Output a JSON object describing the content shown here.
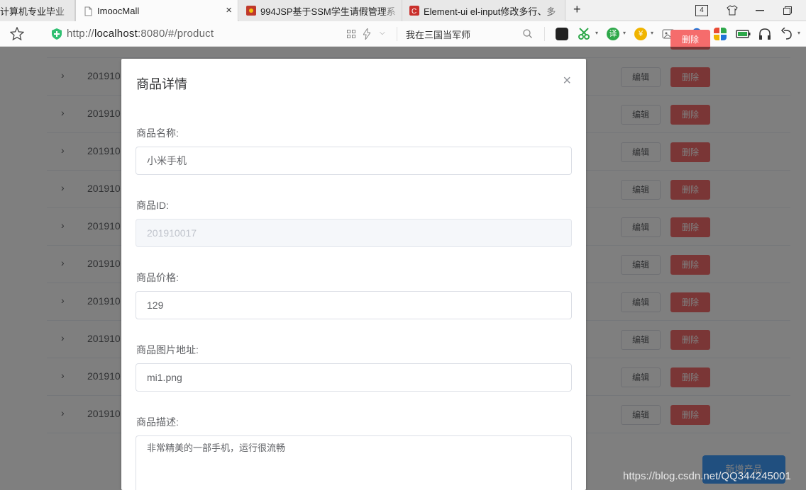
{
  "browser": {
    "tabs": [
      {
        "label": "计算机专业毕业",
        "active": false
      },
      {
        "label": "ImoocMall",
        "active": true
      },
      {
        "label": "994JSP基于SSM学生请假管理系",
        "active": false
      },
      {
        "label": "Element-ui el-input修改多行、多",
        "active": false
      }
    ],
    "tab_count": "4",
    "new_tab": "+",
    "close_tab": "×",
    "url_prefix": "http://",
    "url_host": "localhost",
    "url_rest": ":8080/#/product",
    "search_text": "我在三国当军师",
    "accent_green": "#2fbf71"
  },
  "table": {
    "row_id": "201910",
    "edit_label": "编辑",
    "delete_label": "删除",
    "row_count": 10
  },
  "add_button": "新增产品",
  "dialog": {
    "title": "商品详情",
    "close": "×",
    "fields": {
      "name_label": "商品名称:",
      "name_value": "小米手机",
      "id_label": "商品ID:",
      "id_value": "201910017",
      "price_label": "商品价格:",
      "price_value": "129",
      "image_label": "商品图片地址:",
      "image_value": "mi1.png",
      "desc_label": "商品描述:",
      "desc_value": "非常精美的一部手机，运行很流畅"
    }
  },
  "watermark": "https://blog.csdn.net/QQ344245001"
}
